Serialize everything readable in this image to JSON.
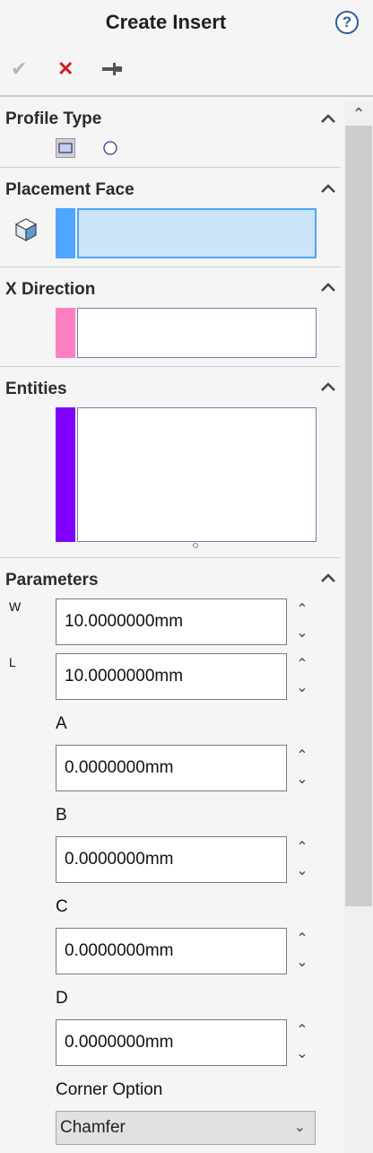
{
  "header": {
    "title": "Create Insert",
    "help_glyph": "?",
    "ok_glyph": "✔",
    "cancel_glyph": "✕",
    "pin_glyph": "⊸"
  },
  "scrollbar": {
    "up_glyph": "⌃"
  },
  "sections": {
    "profile_type": {
      "title": "Profile Type"
    },
    "placement_face": {
      "title": "Placement Face",
      "color": "#4da6ff"
    },
    "x_direction": {
      "title": "X Direction",
      "color": "#ff80c0"
    },
    "entities": {
      "title": "Entities",
      "color": "#8000ff"
    },
    "parameters": {
      "title": "Parameters"
    }
  },
  "params": {
    "w": {
      "label": "W",
      "value": "10.0000000mm"
    },
    "l": {
      "label": "L",
      "value": "10.0000000mm"
    },
    "a": {
      "label": "A",
      "value": "0.0000000mm"
    },
    "b": {
      "label": "B",
      "value": "0.0000000mm"
    },
    "c": {
      "label": "C",
      "value": "0.0000000mm"
    },
    "d": {
      "label": "D",
      "value": "0.0000000mm"
    }
  },
  "corner_option": {
    "label": "Corner Option",
    "selected": "Chamfer"
  }
}
